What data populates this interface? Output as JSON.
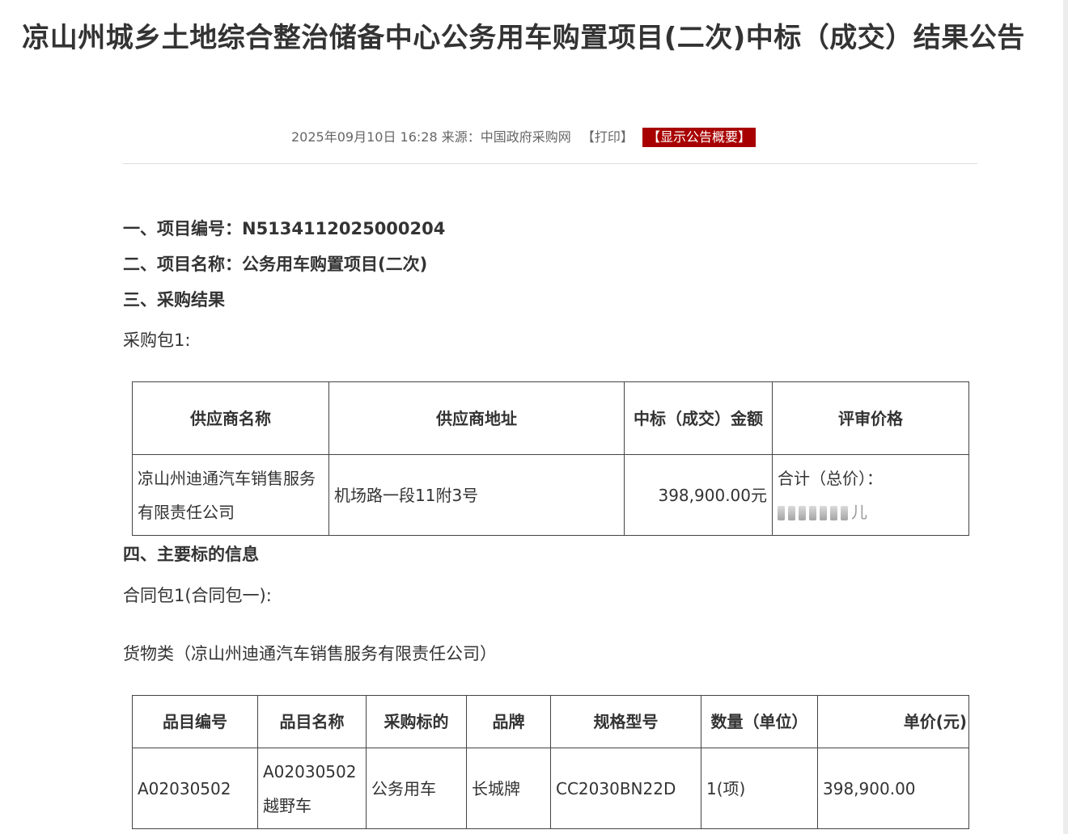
{
  "article": {
    "title": "凉山州城乡土地综合整治储备中心公务用车购置项目(二次)中标（成交）结果公告",
    "date": "2025年09月10日 16:28",
    "source_label": "来源：",
    "source": "中国政府采购网",
    "print_label": "【打印】",
    "summary_label": "【显示公告概要】"
  },
  "sections": {
    "s1_label": "一、项目编号：",
    "s1_value": "N5134112025000204",
    "s2_label": "二、项目名称：",
    "s2_value": "公务用车购置项目(二次)",
    "s3": "三、采购结果",
    "package": "采购包1:",
    "s4": "四、主要标的信息",
    "contract": "合同包1(合同包一):",
    "goods": "货物类（凉山州迪通汽车销售服务有限责任公司）"
  },
  "result_table": {
    "headers": [
      "供应商名称",
      "供应商地址",
      "中标（成交）金额",
      "评审价格"
    ],
    "row": {
      "supplier": "凉山州迪通汽车销售服务有限责任公司",
      "address": "机场路一段11附3号",
      "amount": "398,900.00元",
      "price_label": "合计（总价）：",
      "price_tail": "儿"
    }
  },
  "item_table": {
    "headers": [
      "品目编号",
      "品目名称",
      "采购标的",
      "品牌",
      "规格型号",
      "数量（单位）",
      "单价(元)"
    ],
    "row": {
      "code": "A02030502",
      "name": "A02030502越野车",
      "target": "公务用车",
      "brand": "长城牌",
      "model": "CC2030BN22D",
      "qty": "1(项)",
      "price": "398,900.00"
    }
  }
}
